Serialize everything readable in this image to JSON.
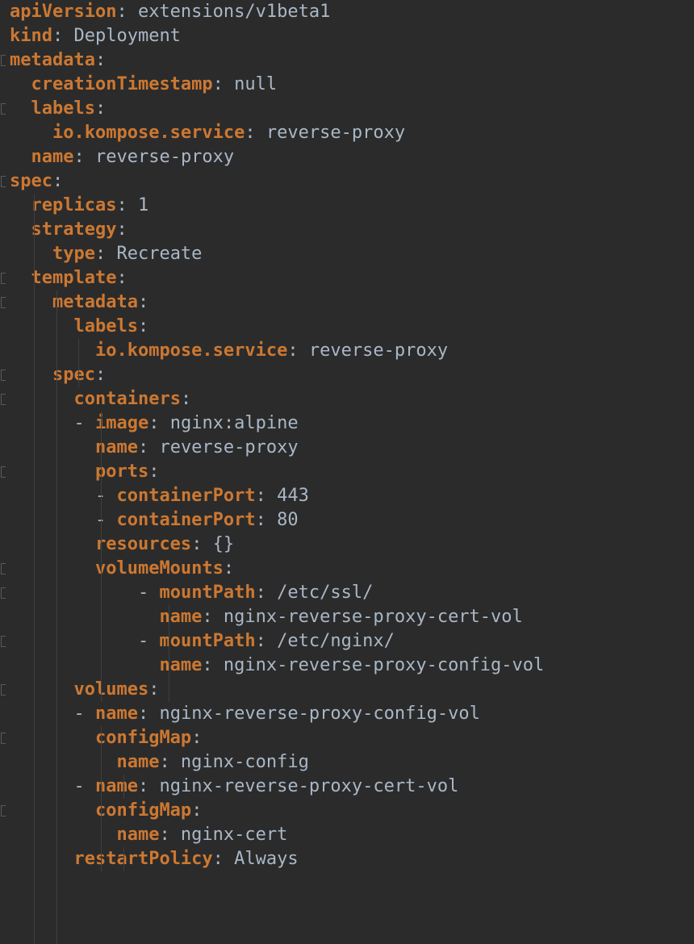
{
  "colors": {
    "background": "#2b2b2b",
    "key": "#cc7832",
    "value": "#a9b7c6",
    "indent_guide": "#3f3f3f"
  },
  "lines": [
    {
      "key": "apiVersion",
      "value": "extensions/v1beta1"
    },
    {
      "key": "kind",
      "value": "Deployment"
    },
    {
      "key": "metadata",
      "value": ""
    },
    {
      "key": "creationTimestamp",
      "value": "null"
    },
    {
      "key": "labels",
      "value": ""
    },
    {
      "key": "io.kompose.service",
      "value": "reverse-proxy"
    },
    {
      "key": "name",
      "value": "reverse-proxy"
    },
    {
      "key": "spec",
      "value": ""
    },
    {
      "key": "replicas",
      "value": "1"
    },
    {
      "key": "strategy",
      "value": ""
    },
    {
      "key": "type",
      "value": "Recreate"
    },
    {
      "key": "template",
      "value": ""
    },
    {
      "key": "metadata",
      "value": ""
    },
    {
      "key": "labels",
      "value": ""
    },
    {
      "key": "io.kompose.service",
      "value": "reverse-proxy"
    },
    {
      "key": "spec",
      "value": ""
    },
    {
      "key": "containers",
      "value": ""
    },
    {
      "key": "image",
      "value": "nginx:alpine"
    },
    {
      "key": "name",
      "value": "reverse-proxy"
    },
    {
      "key": "ports",
      "value": ""
    },
    {
      "key": "containerPort",
      "value": "443"
    },
    {
      "key": "containerPort",
      "value": "80"
    },
    {
      "key": "resources",
      "value": "{}"
    },
    {
      "key": "volumeMounts",
      "value": ""
    },
    {
      "key": "mountPath",
      "value": "/etc/ssl/"
    },
    {
      "key": "name",
      "value": "nginx-reverse-proxy-cert-vol"
    },
    {
      "key": "mountPath",
      "value": "/etc/nginx/"
    },
    {
      "key": "name",
      "value": "nginx-reverse-proxy-config-vol"
    },
    {
      "key": "volumes",
      "value": ""
    },
    {
      "key": "name",
      "value": "nginx-reverse-proxy-config-vol"
    },
    {
      "key": "configMap",
      "value": ""
    },
    {
      "key": "name",
      "value": "nginx-config"
    },
    {
      "key": "name",
      "value": "nginx-reverse-proxy-cert-vol"
    },
    {
      "key": "configMap",
      "value": ""
    },
    {
      "key": "name",
      "value": "nginx-cert"
    },
    {
      "key": "restartPolicy",
      "value": "Always"
    }
  ]
}
